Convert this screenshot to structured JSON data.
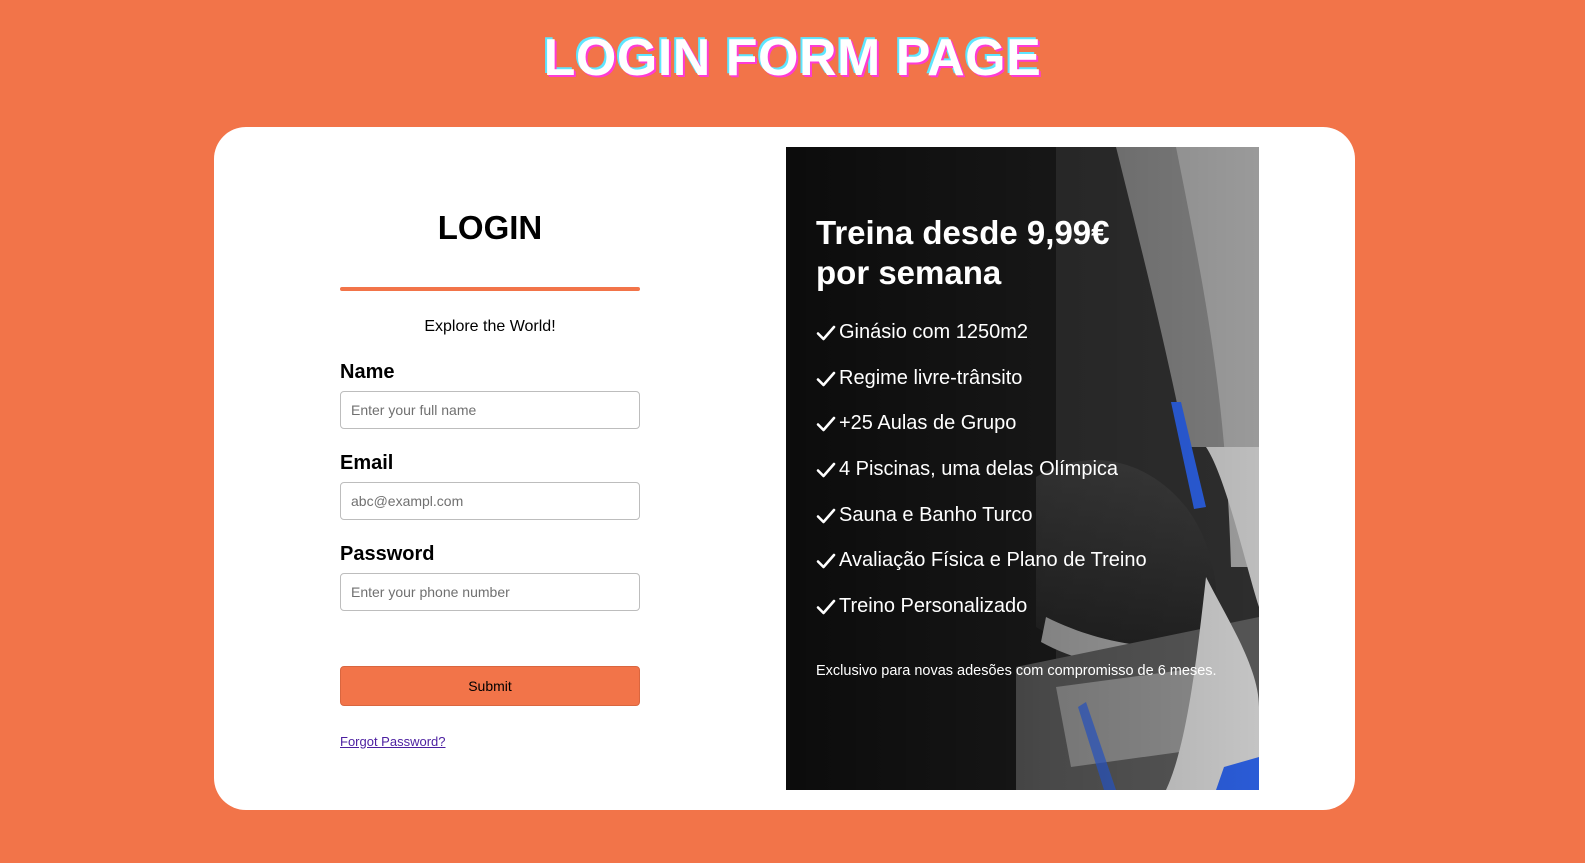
{
  "page": {
    "title": "LOGIN FORM PAGE",
    "background_color": "#f27449"
  },
  "form": {
    "heading": "LOGIN",
    "tagline": "Explore the World!",
    "fields": [
      {
        "label": "Name",
        "placeholder": "Enter your full name",
        "value": ""
      },
      {
        "label": "Email",
        "placeholder": "abc@exampl.com",
        "value": ""
      },
      {
        "label": "Password",
        "placeholder": "Enter your phone number",
        "value": ""
      }
    ],
    "submit_label": "Submit",
    "forgot_label": "Forgot Password?",
    "accent_color": "#f27449"
  },
  "promo": {
    "title_line1": "Treina desde 9,99€",
    "title_line2": "por semana",
    "features": [
      "Ginásio com 1250m2",
      "Regime livre-trânsito",
      "+25 Aulas de Grupo",
      "4 Piscinas, uma delas Olímpica",
      "Sauna e Banho Turco",
      "Avaliação Física e Plano de Treino",
      "Treino Personalizado"
    ],
    "note": "Exclusivo para novas adesões com compromisso de 6 meses.",
    "feature_icon": "check-icon"
  }
}
